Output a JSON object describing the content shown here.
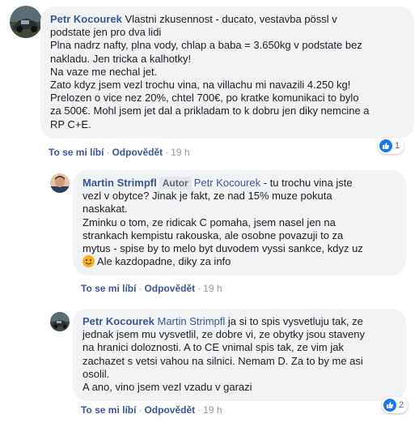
{
  "comments": [
    {
      "author": "Petr Kocourek",
      "first_line_rest": " Vlastni zkusennost - ducato, vestavba pössl v",
      "lines": [
        "podstate jen pro dva lidi",
        "Plna nadrz nafty, plna vody, chlap a baba = 3.650kg v podstate bez",
        "nakladu. Jen tricka a kalhotky!",
        "Na vaze me nechal jet.",
        "Zato kdyz jsem vezl trochu vina, na villachu mi navazili 4.250 kg!",
        "Prelozen o vice nez 20%, chtel 700€, po kratke komunikaci to bylo",
        "za 500€. Mohl jsem jet dal a prikladam to k dobru jen diky nemcine a",
        "RP C+E."
      ],
      "like_label": "To se mi líbí",
      "reply_label": "Odpovědět",
      "time": "19 h",
      "reaction_count": "1"
    },
    {
      "author": "Martin Strimpfl",
      "badge": "Autor",
      "mention": "Petr Kocourek",
      "first_line_rest": " - tu trochu vina jste",
      "lines": [
        "vezl v obytce? Jinak je fakt, ze nad 15% muze pokuta",
        "naskakat.",
        "Zminku o tom, ze ridicak C pomaha, jsem nasel jen na",
        "strankach kempistu rakouska, ale osobne povazuji to za",
        "mytus - spise by to melo byt duvodem vyssi sankce, kdyz uz"
      ],
      "last_line_rest": " Ale kazdopadne, diky za info",
      "emoji": "smile-emoji",
      "like_label": "To se mi líbí",
      "reply_label": "Odpovědět",
      "time": "19 h"
    },
    {
      "author": "Petr Kocourek",
      "mention": "Martin Strimpfl",
      "first_line_rest": " ja si to spis vysvetluju tak, ze",
      "lines": [
        "jednak jsem mu vysvetlil, ze dobre vi, ze obytky jsou staveny",
        "na hranici doloznosti. A to CE vnimal spis tak, ze vim jak",
        "zachazet s vetsi vahou na silnici. Nemam D. Za to by me asi",
        "osolil.",
        "A ano, vino jsem vezl vzadu v garazi"
      ],
      "like_label": "To se mi líbí",
      "reply_label": "Odpovědět",
      "time": "19 h",
      "reaction_count": "2"
    }
  ],
  "separator": "·",
  "colors": {
    "link": "#385898",
    "bubble": "#f2f3f5",
    "meta": "#90949c",
    "like": "#1877f2"
  }
}
